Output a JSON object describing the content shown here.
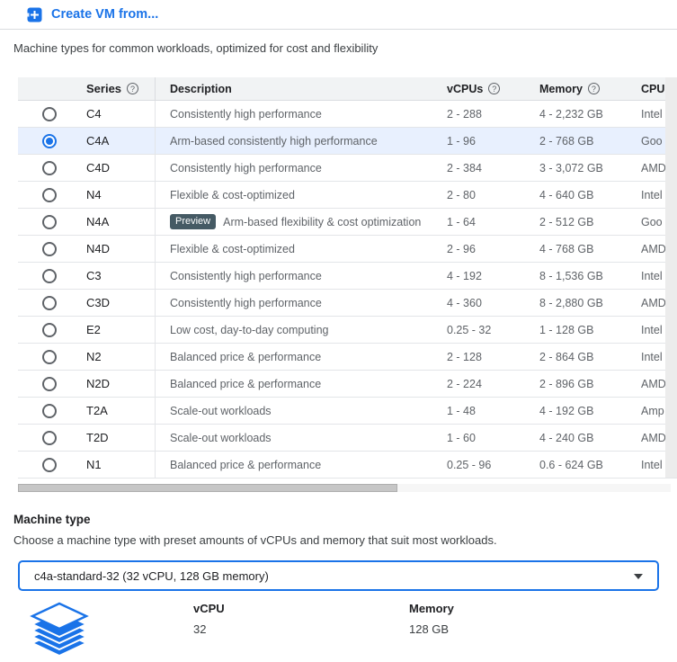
{
  "header": {
    "create_vm_label": "Create VM from...",
    "subtitle": "Machine types for common workloads, optimized for cost and flexibility"
  },
  "table": {
    "columns": {
      "series": "Series",
      "description": "Description",
      "vcpus": "vCPUs",
      "memory": "Memory",
      "cpu": "CPU"
    },
    "help_glyph": "?",
    "rows": [
      {
        "series": "C4",
        "badge": "",
        "description": "Consistently high performance",
        "vcpus": "2 - 288",
        "memory": "4 - 2,232 GB",
        "cpu": "Intel",
        "selected": false
      },
      {
        "series": "C4A",
        "badge": "",
        "description": "Arm-based consistently high performance",
        "vcpus": "1 - 96",
        "memory": "2 - 768 GB",
        "cpu": "Goo",
        "selected": true
      },
      {
        "series": "C4D",
        "badge": "",
        "description": "Consistently high performance",
        "vcpus": "2 - 384",
        "memory": "3 - 3,072 GB",
        "cpu": "AMD",
        "selected": false
      },
      {
        "series": "N4",
        "badge": "",
        "description": "Flexible & cost-optimized",
        "vcpus": "2 - 80",
        "memory": "4 - 640 GB",
        "cpu": "Intel",
        "selected": false
      },
      {
        "series": "N4A",
        "badge": "Preview",
        "description": "Arm-based flexibility & cost optimization",
        "vcpus": "1 - 64",
        "memory": "2 - 512 GB",
        "cpu": "Goo",
        "selected": false
      },
      {
        "series": "N4D",
        "badge": "",
        "description": "Flexible & cost-optimized",
        "vcpus": "2 - 96",
        "memory": "4 - 768 GB",
        "cpu": "AMD",
        "selected": false
      },
      {
        "series": "C3",
        "badge": "",
        "description": "Consistently high performance",
        "vcpus": "4 - 192",
        "memory": "8 - 1,536 GB",
        "cpu": "Intel",
        "selected": false
      },
      {
        "series": "C3D",
        "badge": "",
        "description": "Consistently high performance",
        "vcpus": "4 - 360",
        "memory": "8 - 2,880 GB",
        "cpu": "AMD",
        "selected": false
      },
      {
        "series": "E2",
        "badge": "",
        "description": "Low cost, day-to-day computing",
        "vcpus": "0.25 - 32",
        "memory": "1 - 128 GB",
        "cpu": "Intel",
        "selected": false
      },
      {
        "series": "N2",
        "badge": "",
        "description": "Balanced price & performance",
        "vcpus": "2 - 128",
        "memory": "2 - 864 GB",
        "cpu": "Intel",
        "selected": false
      },
      {
        "series": "N2D",
        "badge": "",
        "description": "Balanced price & performance",
        "vcpus": "2 - 224",
        "memory": "2 - 896 GB",
        "cpu": "AMD",
        "selected": false
      },
      {
        "series": "T2A",
        "badge": "",
        "description": "Scale-out workloads",
        "vcpus": "1 - 48",
        "memory": "4 - 192 GB",
        "cpu": "Amp",
        "selected": false
      },
      {
        "series": "T2D",
        "badge": "",
        "description": "Scale-out workloads",
        "vcpus": "1 - 60",
        "memory": "4 - 240 GB",
        "cpu": "AMD",
        "selected": false
      },
      {
        "series": "N1",
        "badge": "",
        "description": "Balanced price & performance",
        "vcpus": "0.25 - 96",
        "memory": "0.6 - 624 GB",
        "cpu": "Intel",
        "selected": false
      }
    ]
  },
  "machine_type": {
    "heading": "Machine type",
    "description": "Choose a machine type with preset amounts of vCPUs and memory that suit most workloads.",
    "selected_value": "c4a-standard-32 (32 vCPU, 128 GB memory)",
    "details": {
      "vcpu_label": "vCPU",
      "vcpu_value": "32",
      "memory_label": "Memory",
      "memory_value": "128 GB"
    }
  },
  "colors": {
    "accent_blue": "#1a73e8",
    "selected_row_bg": "#e8f0fe",
    "badge_bg": "#455a64"
  }
}
